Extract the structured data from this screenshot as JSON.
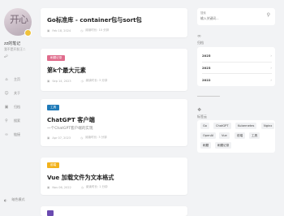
{
  "profile": {
    "avatar_text": "开心",
    "site_name": "zz的笔记",
    "site_desc": "我不是开发汪二"
  },
  "nav": [
    {
      "label": "主页",
      "icon": "home-icon"
    },
    {
      "label": "关于",
      "icon": "user-icon"
    },
    {
      "label": "归档",
      "icon": "archive-icon"
    },
    {
      "label": "搜索",
      "icon": "search-icon"
    },
    {
      "label": "链接",
      "icon": "link-icon"
    }
  ],
  "nav_bottom": {
    "label": "暗色模式",
    "icon": "toggle-icon"
  },
  "posts": [
    {
      "title": "Go标准库 - container包与sort包",
      "tag": "",
      "tag_color": "",
      "subtitle": "",
      "date": "Feb 18, 2024",
      "read": "阅读时长: 10 分钟"
    },
    {
      "title": "第k个最大元素",
      "tag": "刷题记录",
      "tag_color": "#e06c8c",
      "subtitle": "",
      "date": "Sep 14, 2023",
      "read": "阅读时长: 3 分钟"
    },
    {
      "title": "ChatGPT 客户端",
      "tag": "工具",
      "tag_color": "#1f7ab8",
      "subtitle": "一个ChatGPT客户端的实现",
      "date": "Apr 07, 2023",
      "read": "阅读时长: 3 分钟"
    },
    {
      "title": "Vue 加载文件为文本格式",
      "tag": "前端",
      "tag_color": "#f2b21c",
      "subtitle": "",
      "date": "Nov 06, 2022",
      "read": "阅读时长: 1 分钟"
    }
  ],
  "search": {
    "label": "搜索",
    "placeholder": "输入关键词..."
  },
  "archive": {
    "title": "归档",
    "years": [
      "2025",
      "2023",
      "2022"
    ]
  },
  "tags": {
    "title": "标签云",
    "items": [
      "Go",
      "ChatGPT",
      "Kubernetes",
      "Nginx",
      "OpenAI",
      "Vue",
      "前端",
      "工具",
      "刷题",
      "刷题记录"
    ]
  }
}
